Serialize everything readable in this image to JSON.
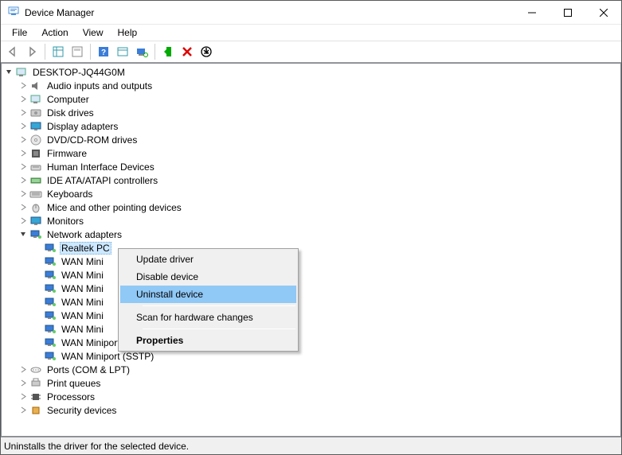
{
  "title": "Device Manager",
  "menu": {
    "file": "File",
    "action": "Action",
    "view": "View",
    "help": "Help"
  },
  "status": "Uninstalls the driver for the selected device.",
  "tree": {
    "root": "DESKTOP-JQ44G0M",
    "cats": {
      "audio": "Audio inputs and outputs",
      "computer": "Computer",
      "disks": "Disk drives",
      "display": "Display adapters",
      "dvd": "DVD/CD-ROM drives",
      "firmware": "Firmware",
      "hid": "Human Interface Devices",
      "ide": "IDE ATA/ATAPI controllers",
      "keyboards": "Keyboards",
      "mice": "Mice and other pointing devices",
      "monitors": "Monitors",
      "network": "Network adapters",
      "ports": "Ports (COM & LPT)",
      "printq": "Print queues",
      "processors": "Processors",
      "security": "Security devices"
    },
    "network_children": {
      "realtek": "Realtek PC",
      "wan1": "WAN Mini",
      "wan2": "WAN Mini",
      "wan3": "WAN Mini",
      "wan4": "WAN Mini",
      "wan5": "WAN Mini",
      "wan6": "WAN Mini",
      "wan7": "WAN Miniport (PPTP)",
      "wan8": "WAN Miniport (SSTP)"
    }
  },
  "ctx": {
    "update": "Update driver",
    "disable": "Disable device",
    "uninstall": "Uninstall device",
    "scan": "Scan for hardware changes",
    "properties": "Properties"
  }
}
